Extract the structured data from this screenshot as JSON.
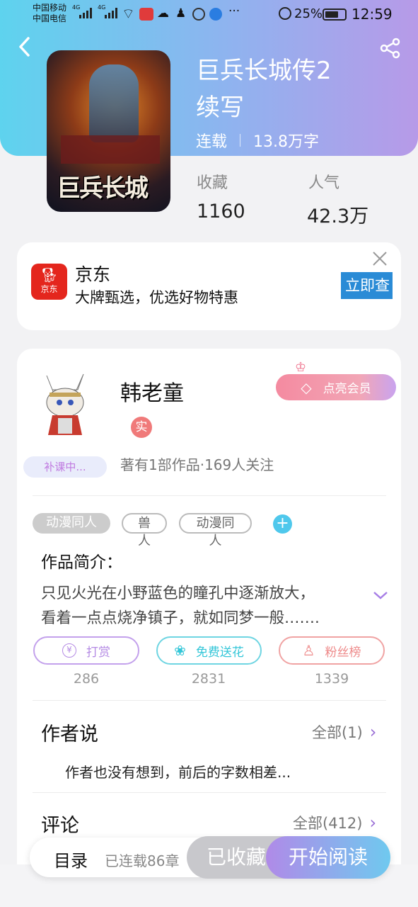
{
  "status_bar": {
    "carrier_1": "中国移动",
    "carrier_2": "中国电信",
    "net_1": "4G",
    "net_2": "4G",
    "more": "···",
    "battery_pct": "25%",
    "time": "12:59"
  },
  "book": {
    "title_line1": "巨兵长城传2",
    "title_line2": "续写",
    "status": "连载",
    "word_count": "13.8万字",
    "cover_text": "巨兵长城",
    "stats": [
      {
        "label": "收藏",
        "value": "1160"
      },
      {
        "label": "人气",
        "value": "42.3万"
      }
    ]
  },
  "ad": {
    "logo_text": "京东",
    "title": "京东",
    "subtitle": "大牌甄选，优选好物特惠",
    "cta": "立即查"
  },
  "author": {
    "name": "韩老童",
    "verified_badge": "实",
    "avatar_badge": "补课中...",
    "member_button": "点亮会员",
    "info": "著有1部作品·169人关注"
  },
  "tags": [
    "动漫同人",
    "兽人",
    "动漫同人"
  ],
  "intro": {
    "heading": "作品简介：",
    "line1": "只见火光在小野蓝色的瞳孔中逐渐放大，",
    "line2": "看着一点点烧净镇子，就如同梦一般……."
  },
  "actions": [
    {
      "label": "打赏",
      "icon": "¥",
      "count": "286",
      "color": "#b48ae4"
    },
    {
      "label": "免费送花",
      "icon": "❀",
      "count": "2831",
      "color": "#33c6d8"
    },
    {
      "label": "粉丝榜",
      "icon": "♙",
      "count": "1339",
      "color": "#ee8a8a"
    }
  ],
  "author_says": {
    "heading": "作者说",
    "more": "全部(1)",
    "text": "作者也没有想到，前后的字数相差..."
  },
  "comments": {
    "heading": "评论",
    "more": "全部(412)"
  },
  "bottom_bar": {
    "toc": "目录",
    "toc_info": "已连载86章",
    "collected": "已收藏",
    "read": "开始阅读"
  },
  "colors": {
    "accent_purple": "#a77ee6",
    "accent_cyan": "#5ed3ee",
    "jd_red": "#e4261d",
    "member_pink": "#ef7f9a"
  }
}
